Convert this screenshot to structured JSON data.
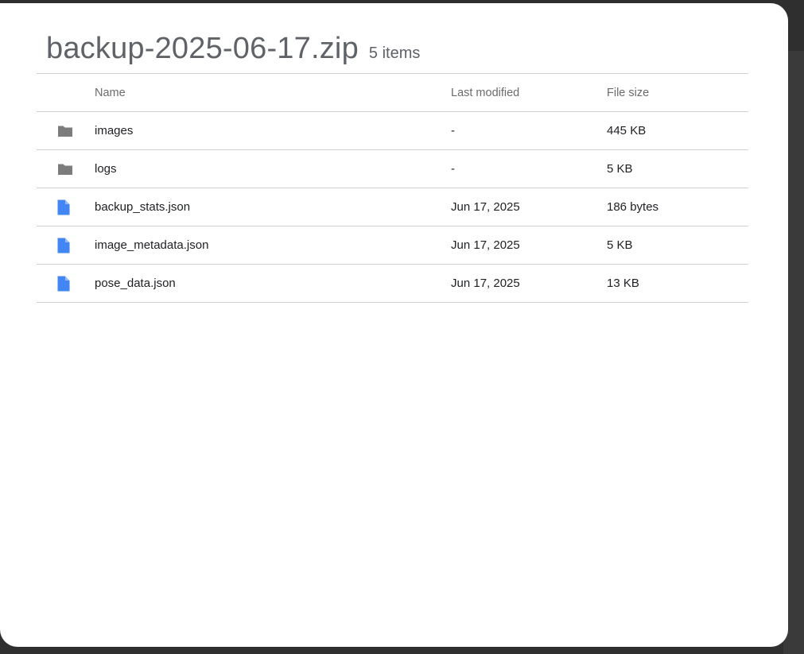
{
  "archive": {
    "title": "backup-2025-06-17.zip",
    "item_count": "5 items"
  },
  "table": {
    "headers": {
      "name": "Name",
      "modified": "Last modified",
      "size": "File size"
    },
    "rows": [
      {
        "type": "folder",
        "icon": "folder-icon",
        "name": "images",
        "modified": "-",
        "size": "445 KB"
      },
      {
        "type": "folder",
        "icon": "folder-icon",
        "name": "logs",
        "modified": "-",
        "size": "5 KB"
      },
      {
        "type": "file",
        "icon": "document-icon",
        "name": "backup_stats.json",
        "modified": "Jun 17, 2025",
        "size": "186 bytes"
      },
      {
        "type": "file",
        "icon": "document-icon",
        "name": "image_metadata.json",
        "modified": "Jun 17, 2025",
        "size": "5 KB"
      },
      {
        "type": "file",
        "icon": "document-icon",
        "name": "pose_data.json",
        "modified": "Jun 17, 2025",
        "size": "13 KB"
      }
    ]
  },
  "colors": {
    "folder_icon": "#7c7c7c",
    "file_icon": "#4285f4",
    "title_text": "#5f6368"
  }
}
